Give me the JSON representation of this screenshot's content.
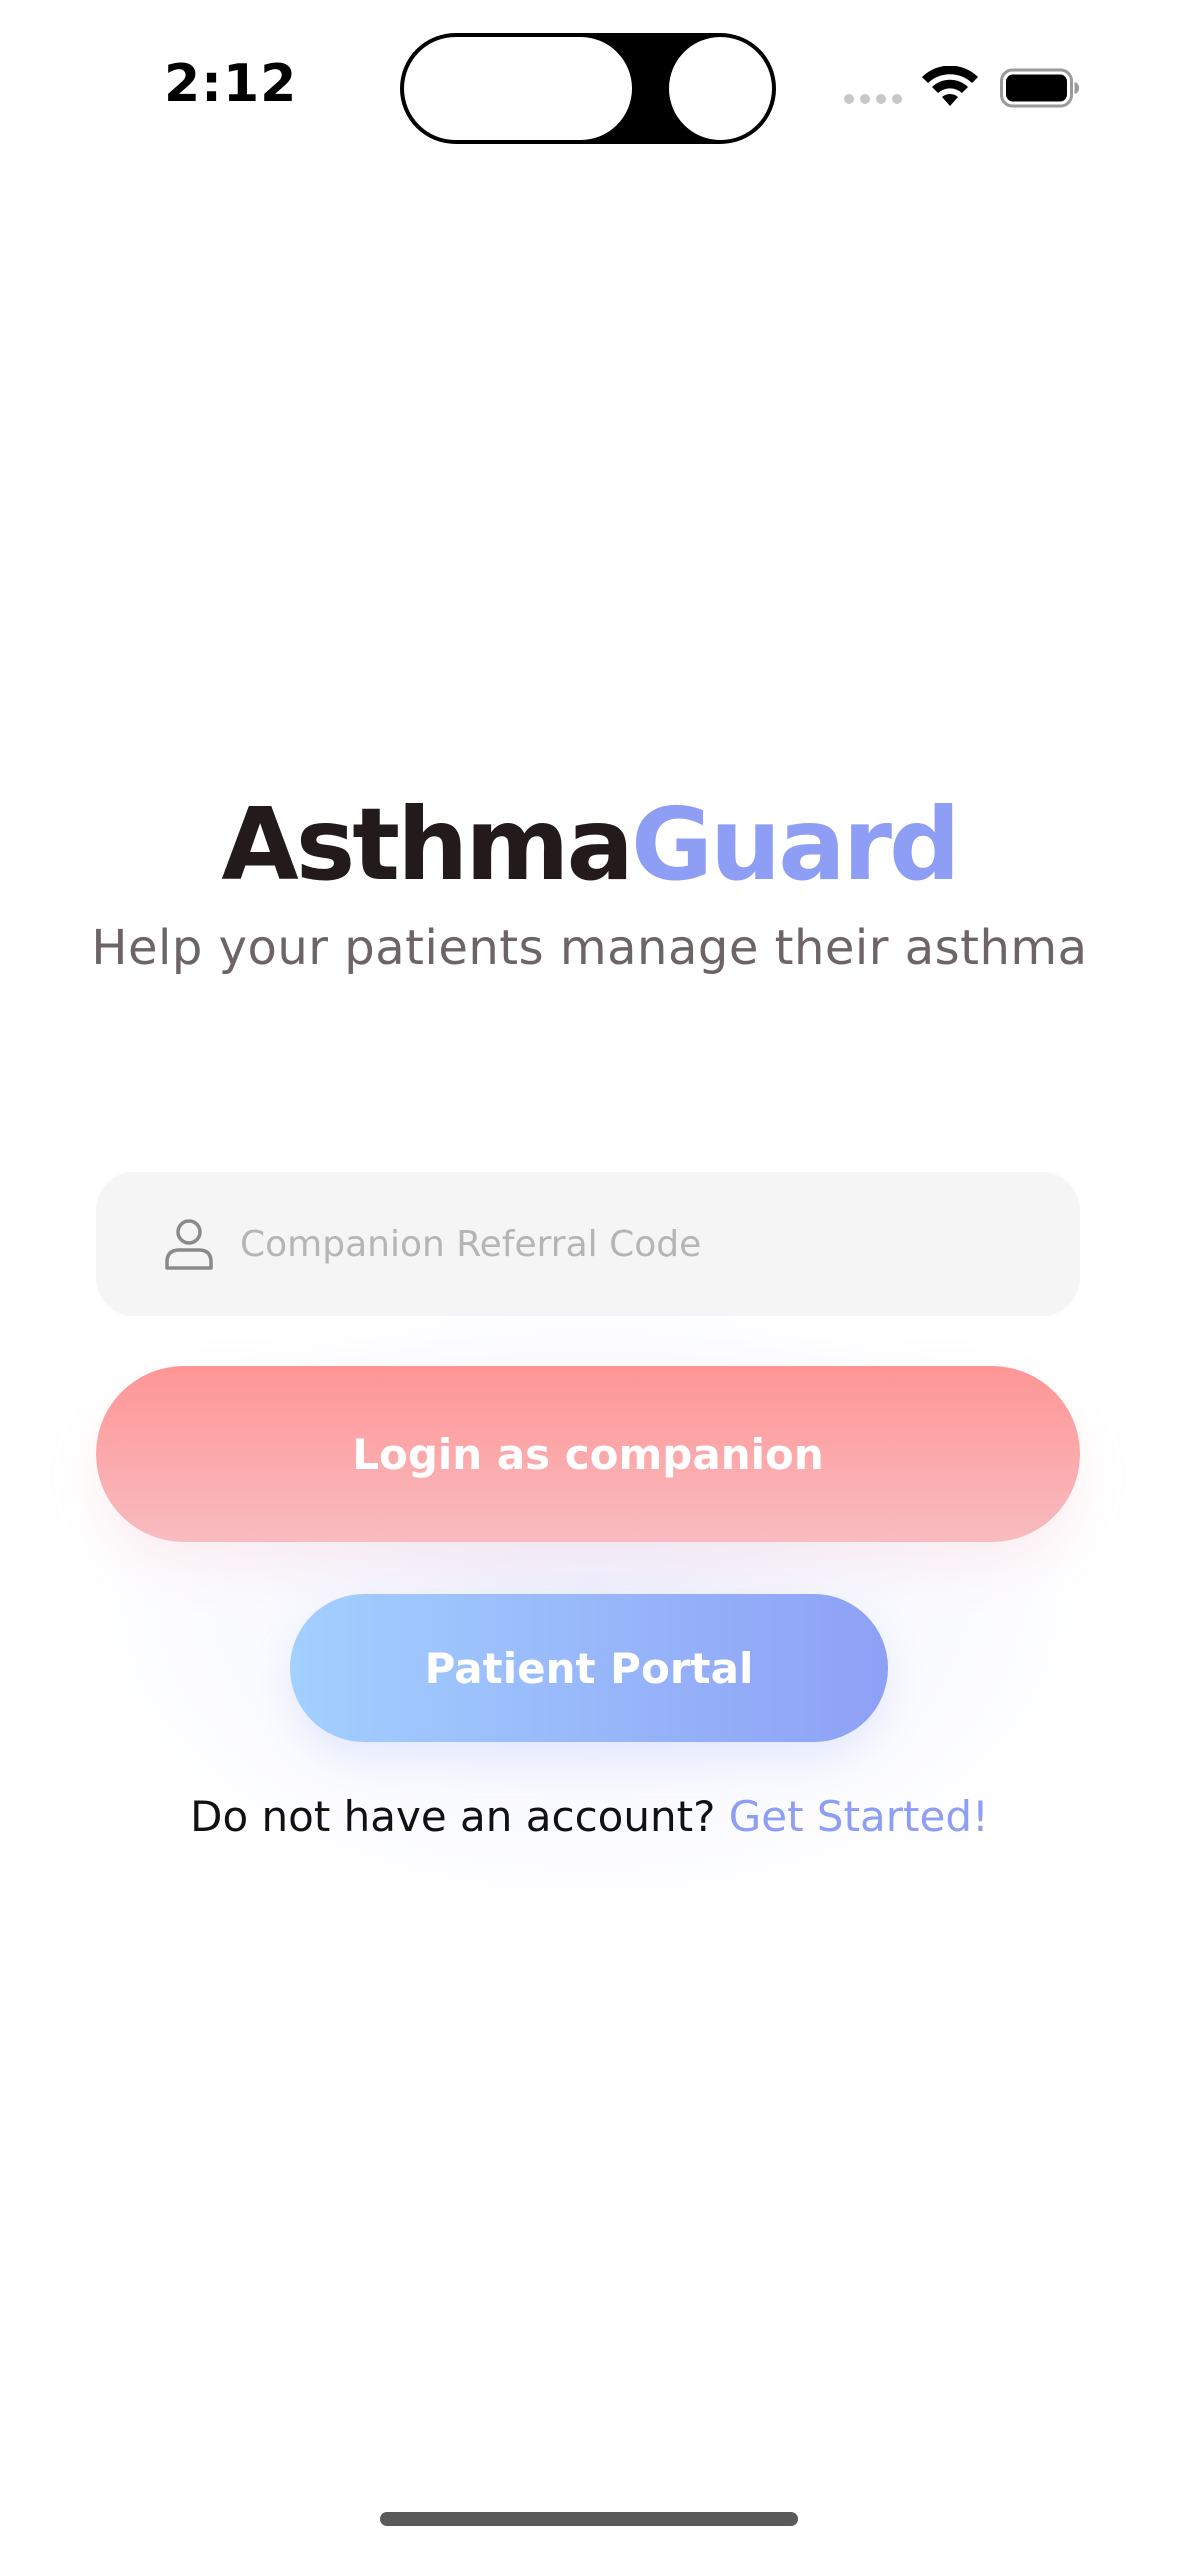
{
  "status_bar": {
    "time": "2:12",
    "icons": [
      "cellular-signal-icon",
      "wifi-icon",
      "battery-icon"
    ]
  },
  "app": {
    "title_part1": "Asthma",
    "title_part2": "Guard",
    "subtitle": "Help your patients manage their asthma"
  },
  "form": {
    "referral_placeholder": "Companion Referral Code",
    "referral_value": "",
    "input_icon": "user-icon"
  },
  "buttons": {
    "login_companion": "Login as companion",
    "patient_portal": "Patient Portal"
  },
  "footer": {
    "prompt": "Do not have an account? ",
    "link": "Get Started!"
  },
  "colors": {
    "title_dark": "#231a1c",
    "accent_blue": "#8e9ef5",
    "companion_gradient_top": "#ff9595",
    "companion_gradient_bottom": "#f8bcc0",
    "patient_gradient_left": "#a2d0ff",
    "patient_gradient_right": "#8ea0f6"
  }
}
